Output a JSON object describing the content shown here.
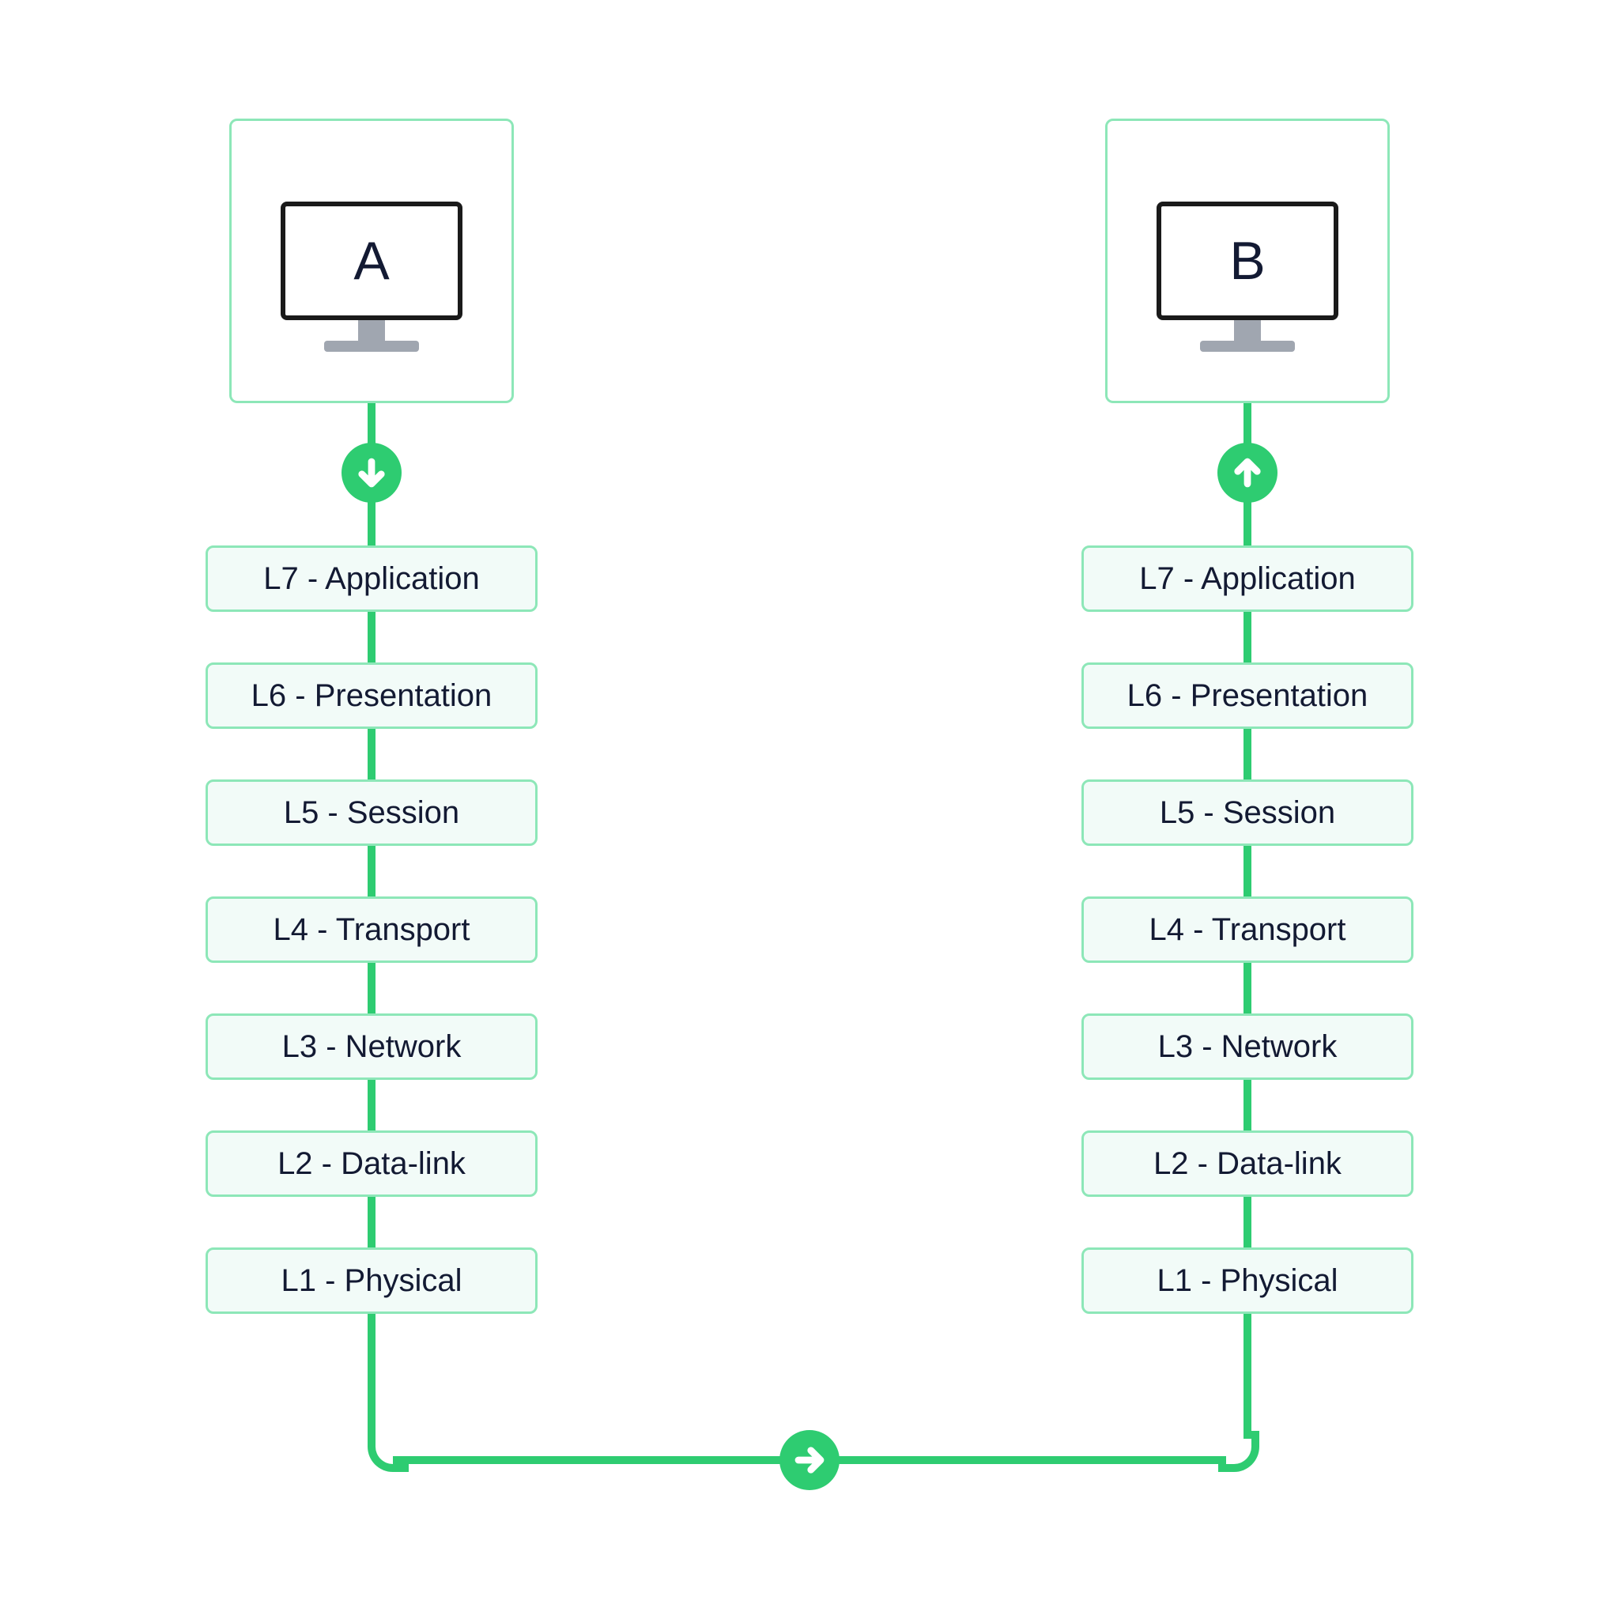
{
  "diagram": {
    "endpoint_a": {
      "label": "A"
    },
    "endpoint_b": {
      "label": "B"
    },
    "layers": [
      "L7 - Application",
      "L6 - Presentation",
      "L5 - Session",
      "L4 - Transport",
      "L3 - Network",
      "L2 - Data-link",
      "L1 - Physical"
    ],
    "arrows": {
      "from_a": "down",
      "across": "right",
      "to_b": "up"
    },
    "colors": {
      "accent": "#2ecc71",
      "accent_light": "#8de7b8",
      "box_bg": "#f2fbf8"
    }
  }
}
